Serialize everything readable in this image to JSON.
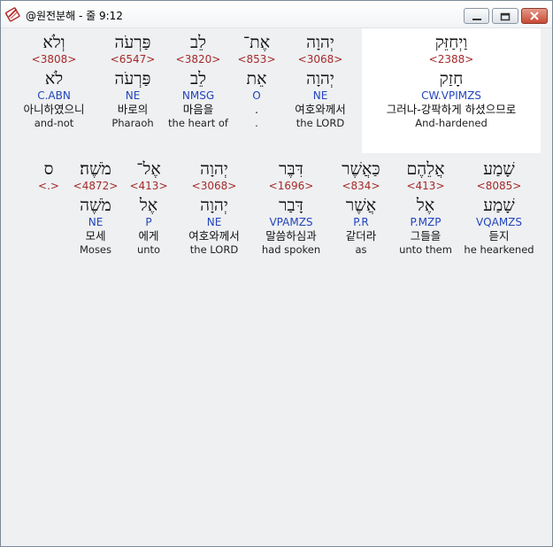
{
  "window": {
    "title": "@원전분해 - 줄 9:12"
  },
  "icons": {
    "app": "bible-app-icon",
    "minimize": "minimize-icon",
    "maximize": "maximize-icon",
    "close": "close-icon"
  },
  "colors": {
    "strong_number": "#a52a2a",
    "morphology": "#2244bb",
    "highlight_bg": "#ffffff"
  },
  "lines": [
    {
      "words": [
        {
          "hebrew": "וַיְחַזֵּק",
          "strong": "<2388>",
          "lemma": "חָזַק",
          "morph": "CW.VPIMZS",
          "korean": "그러나-강팍하게 하셨으므로",
          "english": "And-hardened",
          "highlighted": true
        },
        {
          "hebrew": "יְהוָה",
          "strong": "<3068>",
          "lemma": "יְהוָה",
          "morph": "NE",
          "korean": "여호와께서",
          "english": "the LORD",
          "highlighted": false
        },
        {
          "hebrew": "אֶת־",
          "strong": "<853>",
          "lemma": "אֵת",
          "morph": "O",
          "korean": ".",
          "english": ".",
          "highlighted": false
        },
        {
          "hebrew": "לֵב",
          "strong": "<3820>",
          "lemma": "לֵב",
          "morph": "NMSG",
          "korean": "마음을",
          "english": "the heart of",
          "highlighted": false
        },
        {
          "hebrew": "פַּרְעֹה",
          "strong": "<6547>",
          "lemma": "פַּרְעֹה",
          "morph": "NE",
          "korean": "바로의",
          "english": "Pharaoh",
          "highlighted": false
        },
        {
          "hebrew": "וְלֹא",
          "strong": "<3808>",
          "lemma": "לֹא",
          "morph": "C.ABN",
          "korean": "아니하였으니",
          "english": "and-not",
          "highlighted": false
        }
      ]
    },
    {
      "words": [
        {
          "hebrew": "שָׁמַע",
          "strong": "<8085>",
          "lemma": "שָׁמַע",
          "morph": "VQAMZS",
          "korean": "듣지",
          "english": "he hearkened",
          "highlighted": false
        },
        {
          "hebrew": "אֲלֵהֶם",
          "strong": "<413>",
          "lemma": "אֶל",
          "morph": "P.MZP",
          "korean": "그들을",
          "english": "unto them",
          "highlighted": false
        },
        {
          "hebrew": "כַּאֲשֶׁר",
          "strong": "<834>",
          "lemma": "אֲשֶׁר",
          "morph": "P.R",
          "korean": "같더라",
          "english": "as",
          "highlighted": false
        },
        {
          "hebrew": "דִּבֶּר",
          "strong": "<1696>",
          "lemma": "דָּבַר",
          "morph": "VPAMZS",
          "korean": "말씀하심과",
          "english": "had spoken",
          "highlighted": false
        },
        {
          "hebrew": "יְהוָה",
          "strong": "<3068>",
          "lemma": "יְהוָה",
          "morph": "NE",
          "korean": "여호와께서",
          "english": "the LORD",
          "highlighted": false
        },
        {
          "hebrew": "אֶל־",
          "strong": "<413>",
          "lemma": "אֶל",
          "morph": "P",
          "korean": "에게",
          "english": "unto",
          "highlighted": false
        },
        {
          "hebrew": "מֹשֶׁה׃",
          "strong": "<4872>",
          "lemma": "מֹשֶׁה",
          "morph": "NE",
          "korean": "모세",
          "english": "Moses",
          "highlighted": false
        },
        {
          "hebrew": "ס",
          "strong": "<.>",
          "lemma": "",
          "morph": "",
          "korean": "",
          "english": "",
          "highlighted": false
        }
      ]
    }
  ]
}
